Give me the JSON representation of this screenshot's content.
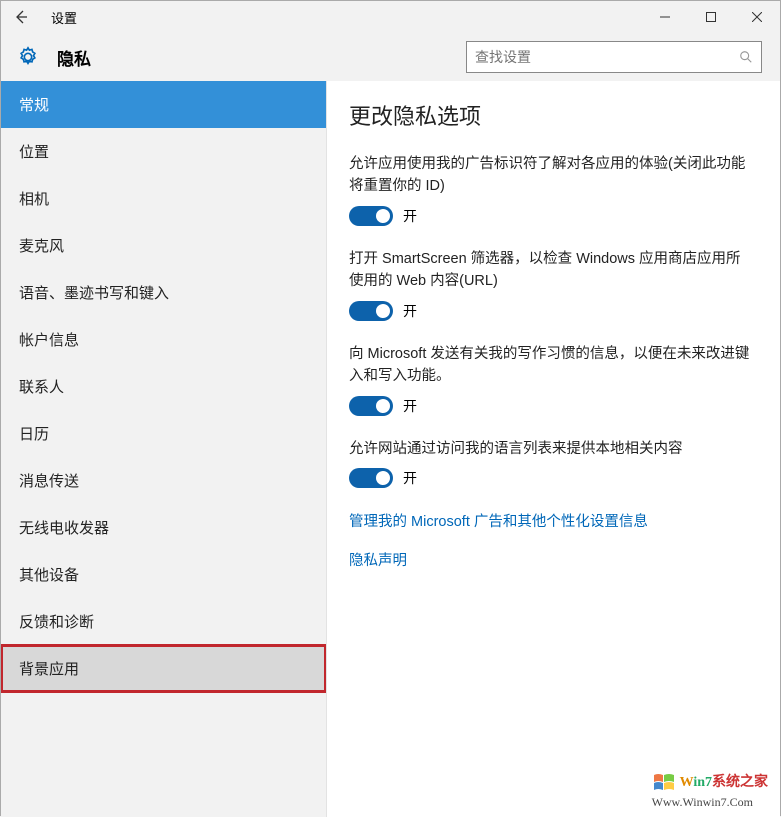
{
  "titlebar": {
    "title": "设置"
  },
  "header": {
    "title": "隐私"
  },
  "search": {
    "placeholder": "查找设置"
  },
  "sidebar": {
    "items": [
      {
        "label": "常规",
        "state": "selected"
      },
      {
        "label": "位置"
      },
      {
        "label": "相机"
      },
      {
        "label": "麦克风"
      },
      {
        "label": "语音、墨迹书写和键入"
      },
      {
        "label": "帐户信息"
      },
      {
        "label": "联系人"
      },
      {
        "label": "日历"
      },
      {
        "label": "消息传送"
      },
      {
        "label": "无线电收发器"
      },
      {
        "label": "其他设备"
      },
      {
        "label": "反馈和诊断"
      },
      {
        "label": "背景应用",
        "state": "highlight"
      }
    ]
  },
  "content": {
    "title": "更改隐私选项",
    "settings": [
      {
        "desc": "允许应用使用我的广告标识符了解对各应用的体验(关闭此功能将重置你的 ID)",
        "state_label": "开"
      },
      {
        "desc": "打开 SmartScreen 筛选器，以检查 Windows 应用商店应用所使用的 Web 内容(URL)",
        "state_label": "开"
      },
      {
        "desc": "向 Microsoft 发送有关我的写作习惯的信息，以便在未来改进键入和写入功能。",
        "state_label": "开"
      },
      {
        "desc": "允许网站通过访问我的语言列表来提供本地相关内容",
        "state_label": "开"
      }
    ],
    "links": [
      "管理我的 Microsoft 广告和其他个性化设置信息",
      "隐私声明"
    ]
  },
  "watermark": {
    "brand_prefix": "W",
    "brand_mid": "in7",
    "brand_suffix": "系统之家",
    "url": "Www.Winwin7.Com"
  }
}
